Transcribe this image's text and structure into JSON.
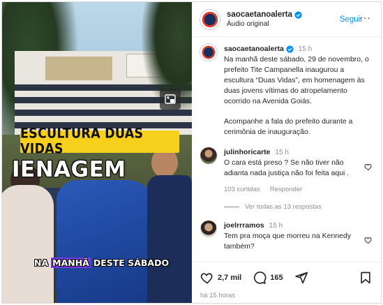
{
  "post": {
    "username": "saocaetanoalerta",
    "audio": "Áudio original",
    "follow_label": "Seguir",
    "more_label": "···"
  },
  "video": {
    "overlay_yellow": "ESCULTURA DUAS VIDAS",
    "overlay_big": "IENAGEM",
    "subtitle_pre": "NA",
    "subtitle_highlight": "MANHÃ",
    "subtitle_post": "DESTE SÁBADO"
  },
  "caption": {
    "username": "saocaetanoalerta",
    "time": "15 h",
    "paragraph1": "Na manhã deste sábado, 29 de novembro, o prefeito Tite Campanella inaugurou a escultura “Duas Vidas”, em homenagem às duas jovens vítimas do atropelamento ocorrido na Avenida Goiás.",
    "paragraph2": "Acompanhe a fala do prefeito durante a cerimônia de inauguração."
  },
  "comments": [
    {
      "username": "julinhoricarte",
      "time": "15 h",
      "text": "O cara está preso ? Se não tiver não adianta nada justiça não foi feita aqui .",
      "likes": "103 curtidas",
      "reply_label": "Responder",
      "view_replies": "Ver todas as 13 respostas"
    },
    {
      "username": "joelrrramos",
      "time": "15 h",
      "text": "Tem pra moça que morreu na Kennedy também?"
    }
  ],
  "actions": {
    "likes": "2,7 mil",
    "comments": "165",
    "posted_ago": "há 15 horas"
  },
  "colors": {
    "accent_blue": "#0095f6",
    "caption_yellow": "#f7cf1d",
    "subtitle_highlight": "#7c3aed"
  }
}
